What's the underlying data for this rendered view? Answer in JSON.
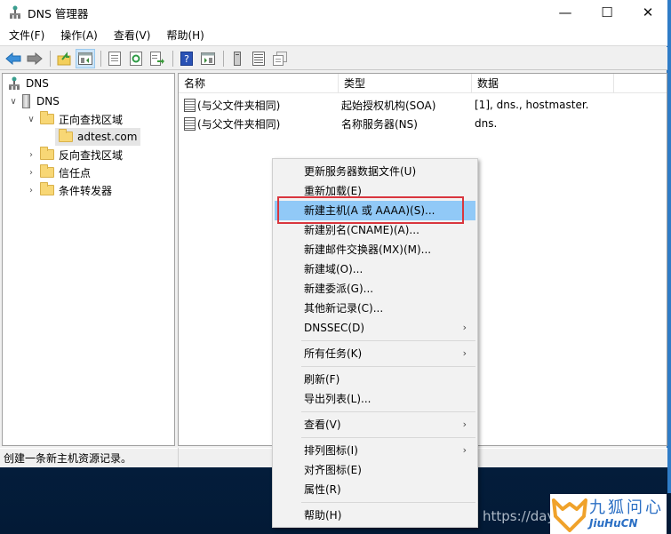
{
  "window": {
    "title": "DNS 管理器",
    "controls": {
      "minimize": "—",
      "maximize": "☐",
      "close": "✕"
    }
  },
  "menubar": {
    "items": [
      "文件(F)",
      "操作(A)",
      "查看(V)",
      "帮助(H)"
    ]
  },
  "toolbar": {
    "buttons": [
      {
        "icon": "back-arrow-icon"
      },
      {
        "icon": "forward-arrow-icon"
      },
      {
        "icon": "up-folder-icon"
      },
      {
        "icon": "show-hide-console-tree-icon",
        "active": true
      },
      {
        "icon": "properties-icon"
      },
      {
        "icon": "refresh-icon"
      },
      {
        "icon": "export-list-icon"
      },
      {
        "icon": "help-icon"
      },
      {
        "icon": "show-hide-action-pane-icon"
      },
      {
        "icon": "server-icon"
      },
      {
        "icon": "list-view-icon"
      },
      {
        "icon": "record-icon"
      }
    ]
  },
  "tree": {
    "root": "DNS",
    "server": "DNS",
    "forward_zones": "正向查找区域",
    "zone_selected": "adtest.com",
    "reverse_zones": "反向查找区域",
    "trust_points": "信任点",
    "conditional_forwarders": "条件转发器"
  },
  "list": {
    "columns": [
      "名称",
      "类型",
      "数据"
    ],
    "rows": [
      {
        "name": "(与父文件夹相同)",
        "type": "起始授权机构(SOA)",
        "data": "[1], dns., hostmaster."
      },
      {
        "name": "(与父文件夹相同)",
        "type": "名称服务器(NS)",
        "data": "dns."
      }
    ]
  },
  "context_menu": {
    "items": [
      {
        "label": "更新服务器数据文件(U)"
      },
      {
        "label": "重新加载(E)"
      },
      {
        "label": "新建主机(A 或 AAAA)(S)...",
        "highlighted": true
      },
      {
        "label": "新建别名(CNAME)(A)..."
      },
      {
        "label": "新建邮件交换器(MX)(M)..."
      },
      {
        "label": "新建域(O)..."
      },
      {
        "label": "新建委派(G)..."
      },
      {
        "label": "其他新记录(C)..."
      },
      {
        "label": "DNSSEC(D)",
        "submenu": true
      },
      {
        "label": "所有任务(K)",
        "submenu": true
      },
      {
        "label": "刷新(F)"
      },
      {
        "label": "导出列表(L)..."
      },
      {
        "label": "查看(V)",
        "submenu": true
      },
      {
        "label": "排列图标(I)",
        "submenu": true
      },
      {
        "label": "对齐图标(E)"
      },
      {
        "label": "属性(R)"
      },
      {
        "label": "帮助(H)"
      }
    ],
    "submenu_arrow": "›"
  },
  "statusbar": {
    "text": "创建一条新主机资源记录。"
  },
  "watermark": {
    "url_text": "https://dayl",
    "logo_cn": "九狐问心",
    "logo_en": "JiuHuCN"
  },
  "colors": {
    "highlight": "#91c9f7",
    "annotation_box": "#d9363e",
    "window_edge": "#2f7cc7"
  }
}
